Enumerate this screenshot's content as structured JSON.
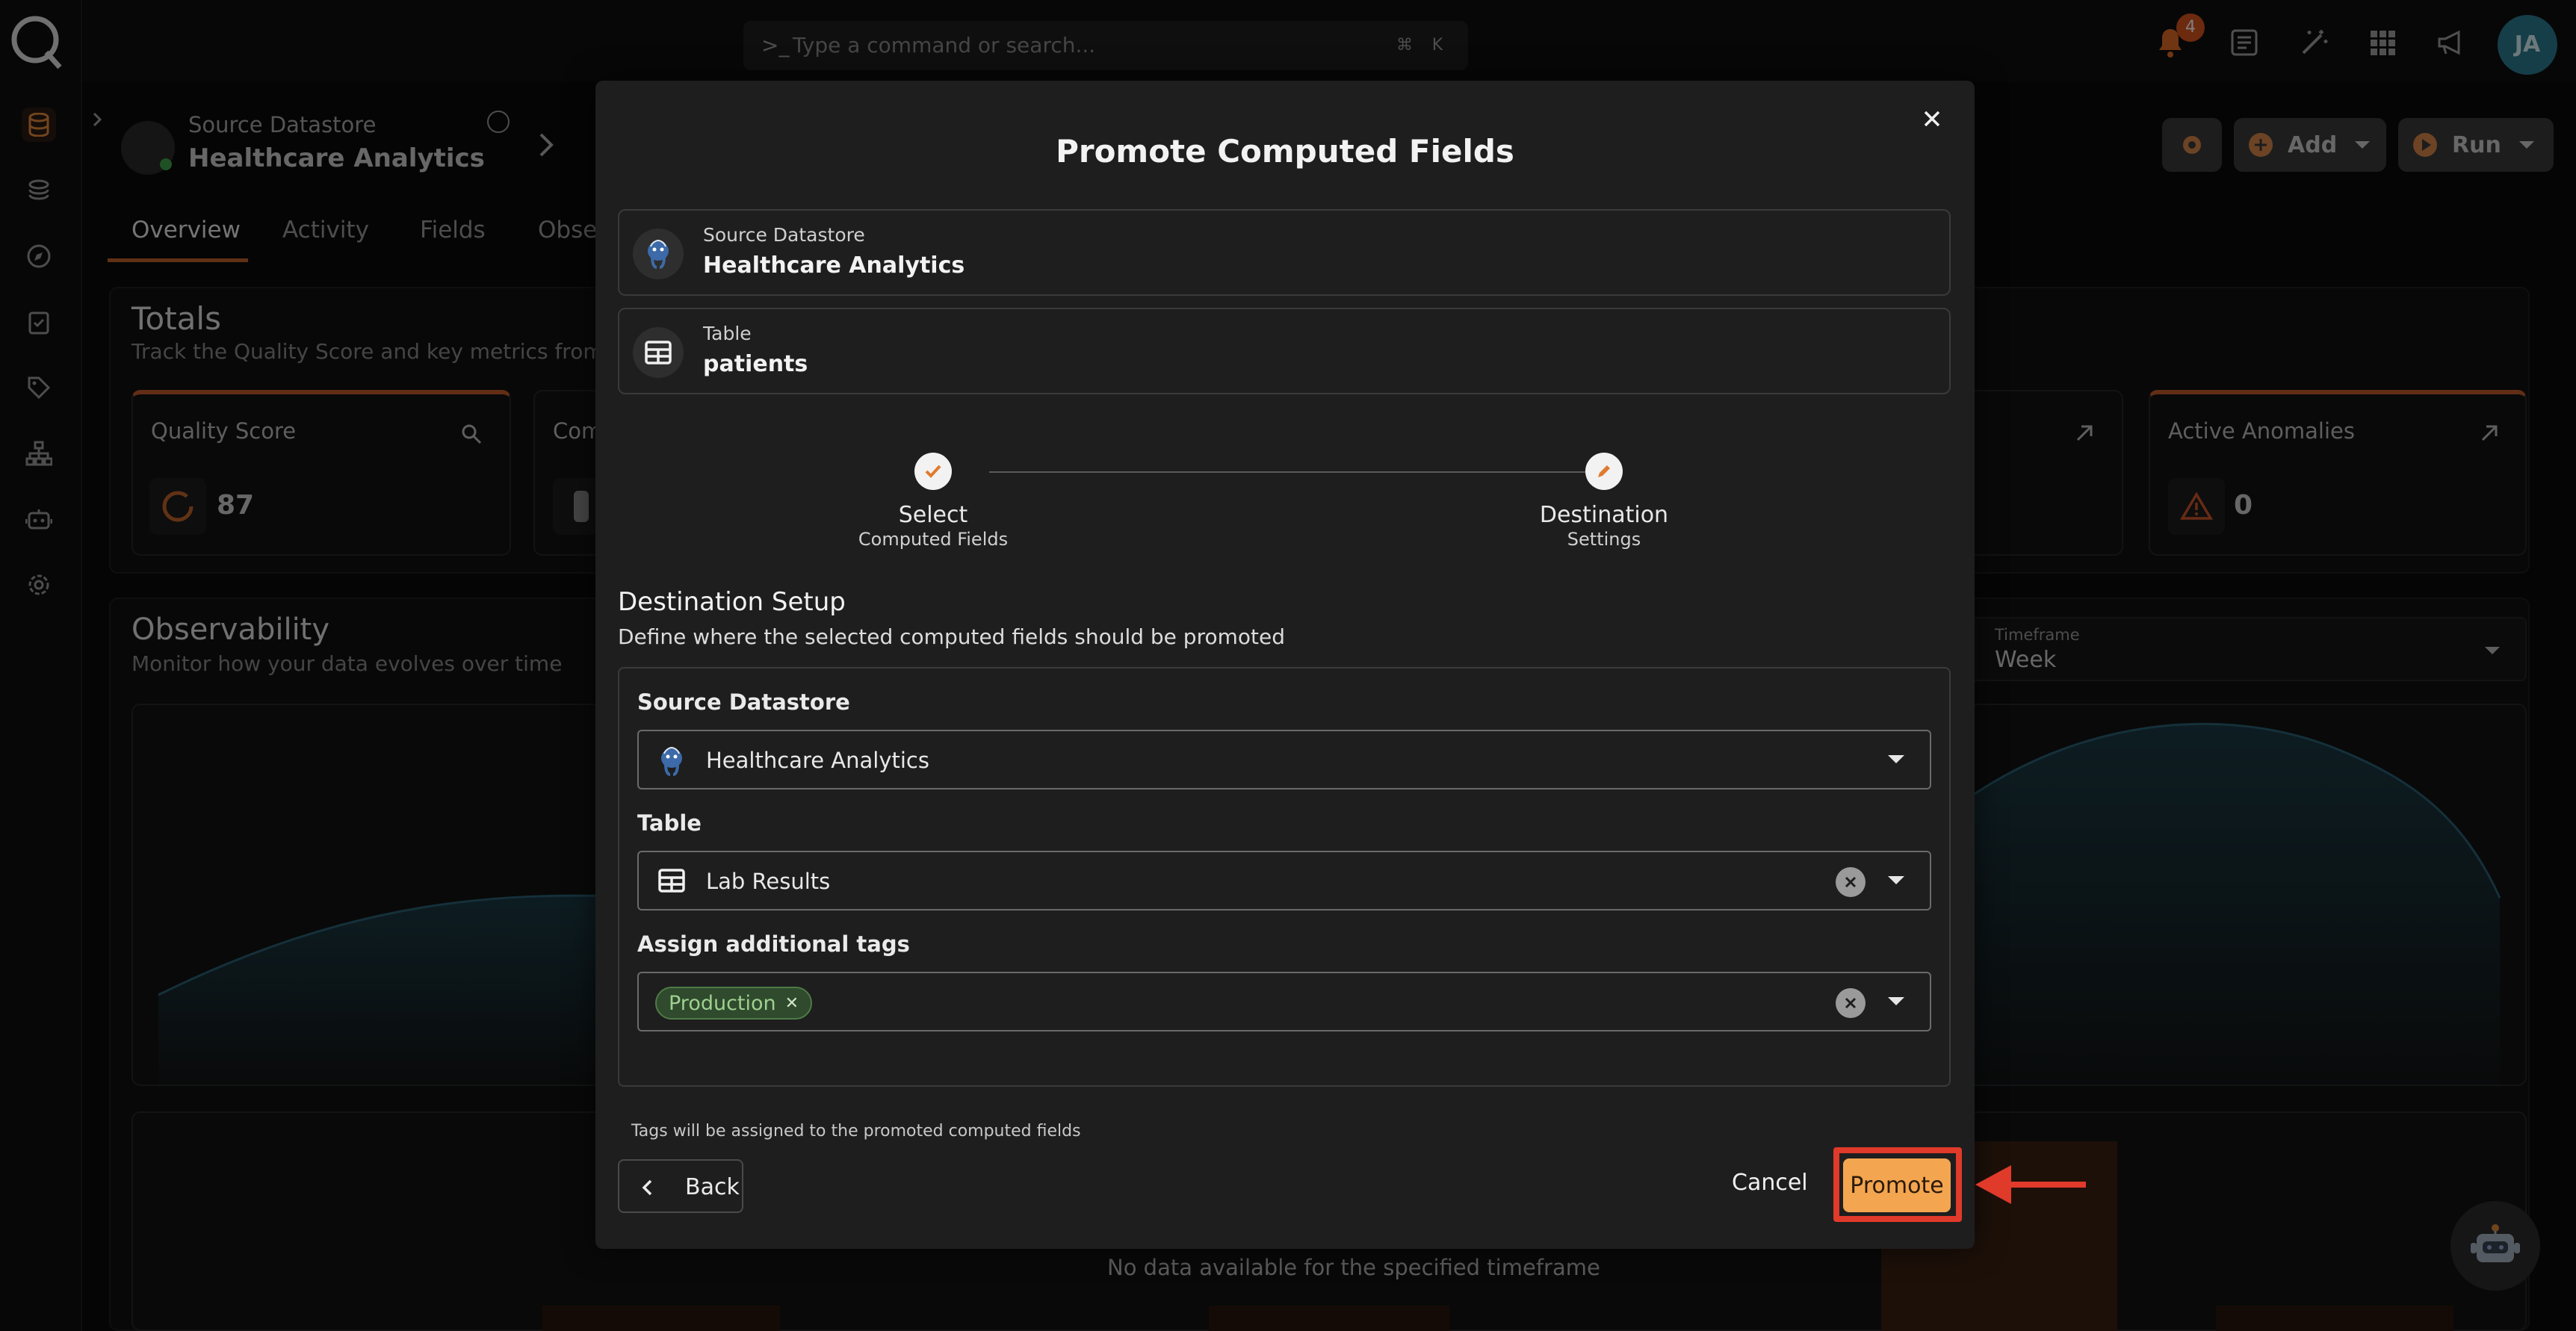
{
  "topbar": {
    "search_prompt": ">_",
    "search_placeholder": "Type a command or search...",
    "shortcut_cmd": "⌘",
    "shortcut_key": "K",
    "notification_count": "4",
    "avatar_initials": "JA"
  },
  "header": {
    "breadcrumb_label": "Source Datastore",
    "breadcrumb_title": "Healthcare Analytics",
    "add_label": "Add",
    "run_label": "Run"
  },
  "tabs": [
    {
      "label": "Overview"
    },
    {
      "label": "Activity"
    },
    {
      "label": "Fields"
    },
    {
      "label": "Obser"
    }
  ],
  "totals": {
    "title": "Totals",
    "subtitle": "Track the Quality Score and key metrics from the",
    "quality_label": "Quality Score",
    "quality_value": "87",
    "comp_label": "Com",
    "anomalies_label": "Active Anomalies",
    "anomalies_value": "0"
  },
  "observability": {
    "title": "Observability",
    "subtitle": "Monitor how your data evolves over time",
    "timeframe_label": "Timeframe",
    "timeframe_value": "Week",
    "empty_message": "No data available for the specified timeframe"
  },
  "modal": {
    "title": "Promote Computed Fields",
    "source_label": "Source Datastore",
    "source_value": "Healthcare Analytics",
    "table_label": "Table",
    "table_value": "patients",
    "steps": [
      {
        "line1": "Select",
        "line2": "Computed Fields"
      },
      {
        "line1": "Destination",
        "line2": "Settings"
      }
    ],
    "section_title": "Destination Setup",
    "section_subtitle": "Define where the selected computed fields should be promoted",
    "datastore_field_label": "Source Datastore",
    "datastore_field_value": "Healthcare Analytics",
    "table_field_label": "Table",
    "table_field_value": "Lab Results",
    "tags_field_label": "Assign additional tags",
    "tag_chip": "Production",
    "tags_helper": "Tags will be assigned to the promoted computed fields",
    "back_label": "Back",
    "cancel_label": "Cancel",
    "promote_label": "Promote"
  },
  "colors": {
    "accent": "#f4a550",
    "highlight": "#e03a2a",
    "tag_green": "#9fd08f"
  }
}
